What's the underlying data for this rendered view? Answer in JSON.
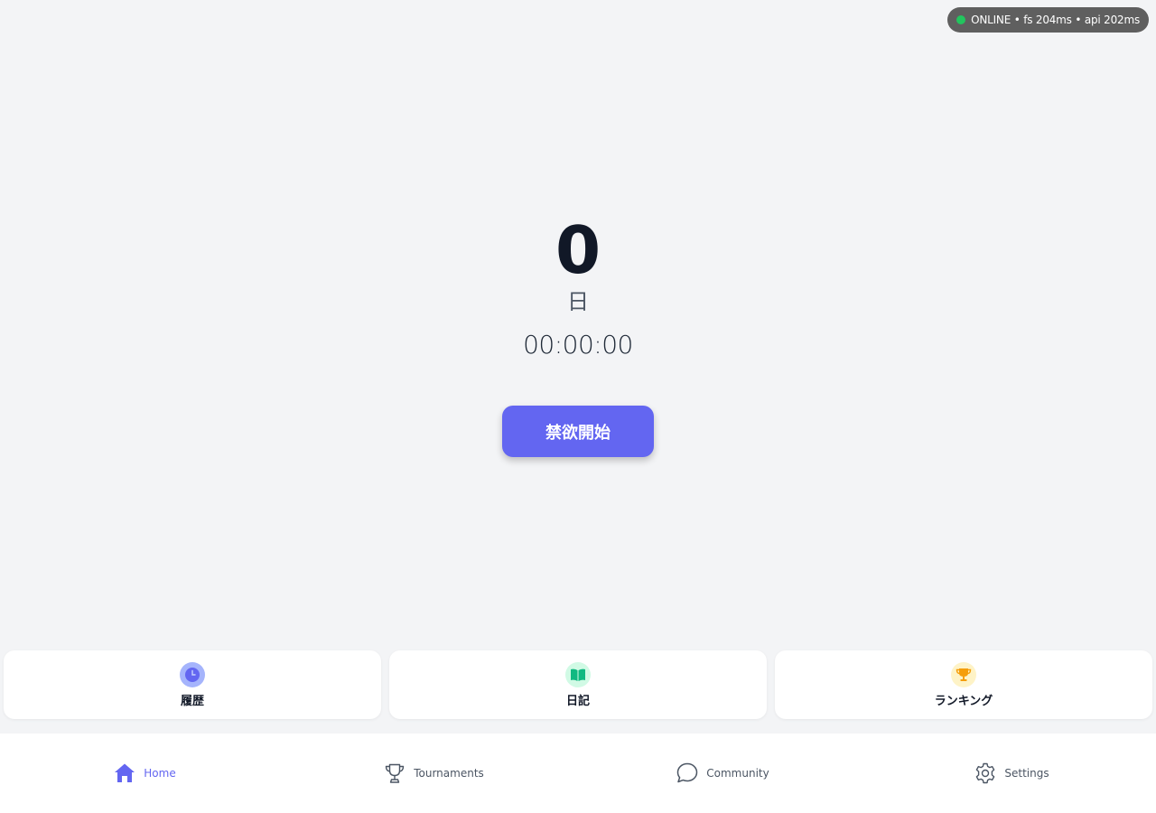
{
  "status": {
    "text": "ONLINE • fs 204ms • api 202ms",
    "dot_color": "#22c55e"
  },
  "counter": {
    "days": "0",
    "unit": "日",
    "elapsed": "00:00:00"
  },
  "start_button": {
    "label": "禁欲開始",
    "color": "#6366f1"
  },
  "quick_cards": [
    {
      "label": "履歴",
      "icon": "clock-icon"
    },
    {
      "label": "日記",
      "icon": "book-icon"
    },
    {
      "label": "ランキング",
      "icon": "trophy-icon"
    }
  ],
  "nav": {
    "active": "Home",
    "items": [
      {
        "label": "Home",
        "icon": "home-icon"
      },
      {
        "label": "Tournaments",
        "icon": "trophy-outline-icon"
      },
      {
        "label": "Community",
        "icon": "chat-bubble-icon"
      },
      {
        "label": "Settings",
        "icon": "gear-icon"
      }
    ]
  }
}
